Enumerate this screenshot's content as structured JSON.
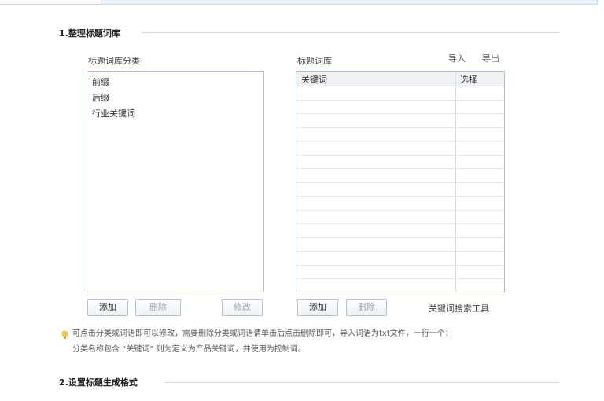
{
  "top_tabs": [
    "",
    ""
  ],
  "section1": {
    "title": "1.整理标题词库"
  },
  "left_panel": {
    "label": "标题词库分类",
    "items": [
      "前缀",
      "后缀",
      "行业关键词"
    ],
    "buttons": {
      "add": "添加",
      "delete": "删除",
      "edit": "修改"
    }
  },
  "right_panel": {
    "label": "标题词库",
    "import_label": "导入",
    "export_label": "导出",
    "columns": [
      "关键词",
      "选择"
    ],
    "rows": 15,
    "buttons": {
      "add": "添加",
      "delete": "删除"
    },
    "tool_link": "关键词搜索工具"
  },
  "hint": {
    "line1": "可点击分类或词语即可以修改，需要删除分类或词语请单击后点击删除即可，导入词语为txt文件，一行一个；",
    "line2": "分类名称包含 “关键词” 则为定义为产品关键词，并使用为控制词。"
  },
  "section2": {
    "title": "2.设置标题生成格式"
  },
  "colors": {
    "border": "#a9c4da",
    "tab_active": "#e7f0fa",
    "hint_icon": "#f5c542"
  }
}
